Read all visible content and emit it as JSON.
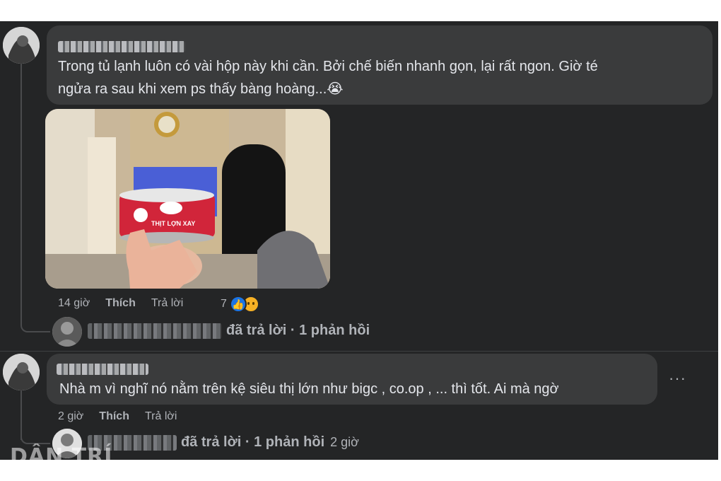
{
  "comment1": {
    "text_line1": "Trong tủ lạnh luôn có vài hộp này khi cần. Bởi chế biến nhanh gọn, lại rất ngon. Giờ té",
    "text_line2": "ngửa ra sau khi xem ps thấy bàng hoàng...😭",
    "photo_label": "THỊT LỢN XAY",
    "time": "14 giờ",
    "like_label": "Thích",
    "reply_label": "Trả lời",
    "reaction_count": "7",
    "replies_summary": "đã trả lời · 1 phản hồi"
  },
  "comment2": {
    "text": "Nhà m vì nghĩ nó nằm trên kệ siêu thị lớn như bigc , co.op , ... thì tốt. Ai mà ngờ",
    "time": "2 giờ",
    "like_label": "Thích",
    "reply_label": "Trả lời",
    "more_label": "···",
    "replies_summary": "đã trả lời · 1 phản hồi",
    "replies_time": "2 giờ"
  },
  "watermark": "DÂN TRÍ",
  "colors": {
    "panel_bg": "#242526",
    "bubble_bg": "#3a3b3c",
    "text": "#e4e6eb",
    "muted": "#b0b3b8",
    "like_blue": "#1b74e4"
  }
}
